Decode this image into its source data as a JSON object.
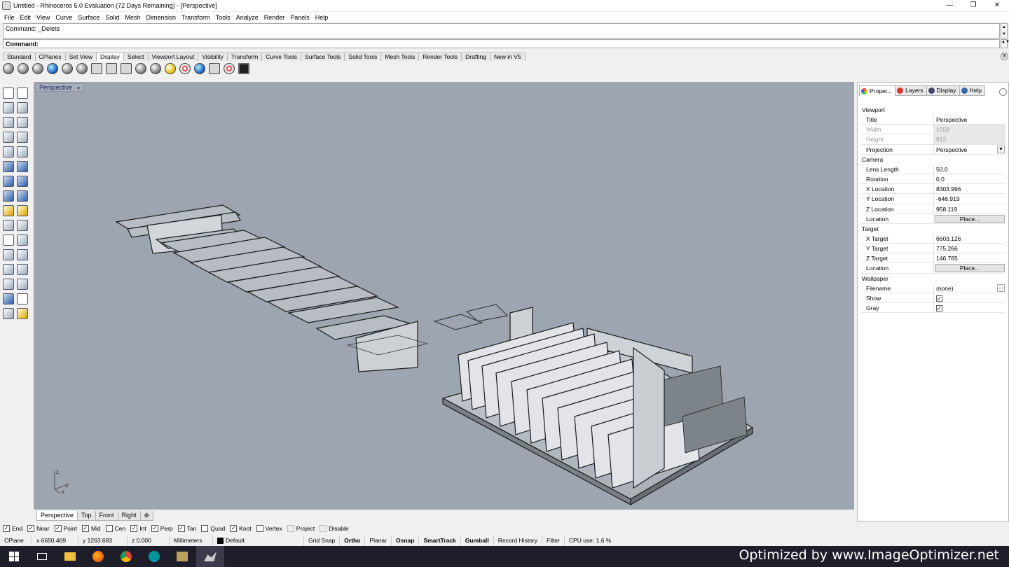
{
  "window": {
    "title": "Untitled - Rhinoceros 5.0 Evaluation (72 Days Remaining) - [Perspective]",
    "min": "—",
    "max": "❐",
    "close": "✕"
  },
  "menu": [
    "File",
    "Edit",
    "View",
    "Curve",
    "Surface",
    "Solid",
    "Mesh",
    "Dimension",
    "Transform",
    "Tools",
    "Analyze",
    "Render",
    "Panels",
    "Help"
  ],
  "command": {
    "history": "Command: _Delete",
    "prompt": "Command:"
  },
  "toolbar_tabs": [
    "Standard",
    "CPlanes",
    "Set View",
    "Display",
    "Select",
    "Viewport Layout",
    "Visibility",
    "Transform",
    "Curve Tools",
    "Surface Tools",
    "Solid Tools",
    "Mesh Tools",
    "Render Tools",
    "Drafting",
    "New in V5"
  ],
  "active_toolbar_tab": "Display",
  "viewport": {
    "title": "Perspective",
    "axis_labels": {
      "z": "z",
      "y": "y",
      "x": "x"
    }
  },
  "viewport_tabs": [
    "Perspective",
    "Top",
    "Front",
    "Right",
    "⊕"
  ],
  "panel": {
    "tabs": [
      "Proper...",
      "Layers",
      "Display",
      "Help"
    ],
    "sections": {
      "viewport": "Viewport",
      "camera": "Camera",
      "target": "Target",
      "wallpaper": "Wallpaper"
    },
    "viewport_rows": [
      {
        "k": "Title",
        "v": "Perspective"
      },
      {
        "k": "Width",
        "v": "1559"
      },
      {
        "k": "Height",
        "v": "812"
      },
      {
        "k": "Projection",
        "v": "Perspective"
      }
    ],
    "camera_rows": [
      {
        "k": "Lens Length",
        "v": "50.0"
      },
      {
        "k": "Rotation",
        "v": "0.0"
      },
      {
        "k": "X Location",
        "v": "8303.996"
      },
      {
        "k": "Y Location",
        "v": "-646.919"
      },
      {
        "k": "Z Location",
        "v": "958.119"
      },
      {
        "k": "Location",
        "v": "Place..."
      }
    ],
    "target_rows": [
      {
        "k": "X Target",
        "v": "6603.126"
      },
      {
        "k": "Y Target",
        "v": "775.266"
      },
      {
        "k": "Z Target",
        "v": "146.765"
      },
      {
        "k": "Location",
        "v": "Place..."
      }
    ],
    "wallpaper_rows": [
      {
        "k": "Filename",
        "v": "(none)"
      },
      {
        "k": "Show",
        "v": "✓"
      },
      {
        "k": "Gray",
        "v": "✓"
      }
    ]
  },
  "osnaps": [
    {
      "label": "End",
      "checked": true
    },
    {
      "label": "Near",
      "checked": true
    },
    {
      "label": "Point",
      "checked": true
    },
    {
      "label": "Mid",
      "checked": true
    },
    {
      "label": "Cen",
      "checked": false
    },
    {
      "label": "Int",
      "checked": true
    },
    {
      "label": "Perp",
      "checked": true
    },
    {
      "label": "Tan",
      "checked": true
    },
    {
      "label": "Quad",
      "checked": false
    },
    {
      "label": "Knot",
      "checked": true
    },
    {
      "label": "Vertex",
      "checked": false
    },
    {
      "label": "Project",
      "checked": false
    },
    {
      "label": "Disable",
      "checked": false
    }
  ],
  "status": {
    "cplane": "CPlane",
    "x": "x 6650.469",
    "y": "y 1263.683",
    "z": "z 0.000",
    "units": "Millimeters",
    "layer": "Default",
    "grid_snap": "Grid Snap",
    "ortho": "Ortho",
    "planar": "Planar",
    "osnap": "Osnap",
    "smarttrack": "SmartTrack",
    "gumball": "Gumball",
    "record_history": "Record History",
    "filter": "Filter",
    "cpu": "CPU use: 1.6 %"
  },
  "watermark": "Optimized by www.ImageOptimizer.net",
  "colors": {
    "viewport_bg": "#9da5b0",
    "taskbar": "#1e1e2a"
  }
}
